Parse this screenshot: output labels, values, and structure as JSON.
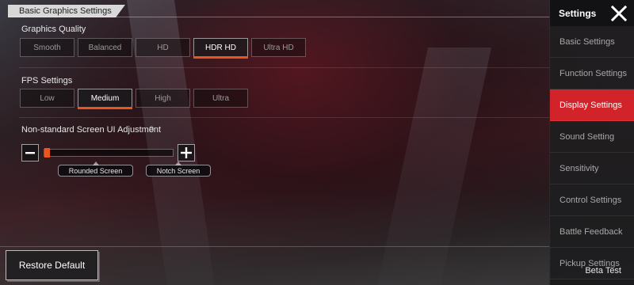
{
  "section_title": "Basic Graphics Settings",
  "graphics_quality": {
    "label": "Graphics Quality",
    "options": [
      "Smooth",
      "Balanced",
      "HD",
      "HDR HD",
      "Ultra HD"
    ],
    "selected": "HDR HD"
  },
  "fps_settings": {
    "label": "FPS Settings",
    "options": [
      "Low",
      "Medium",
      "High",
      "Ultra"
    ],
    "selected": "Medium"
  },
  "screen_adjustment": {
    "label": "Non-standard Screen UI Adjustment",
    "value": "0",
    "minus_icon": "minus-icon",
    "plus_icon": "plus-icon",
    "presets": [
      "Rounded Screen",
      "Notch Screen"
    ]
  },
  "restore_button": "Restore Default",
  "sidebar": {
    "title": "Settings",
    "close_icon": "close-icon",
    "items": [
      "Basic Settings",
      "Function Settings",
      "Display Settings",
      "Sound Setting",
      "Sensitivity",
      "Control Settings",
      "Battle Feedback",
      "Pickup Settings"
    ],
    "active": "Display Settings"
  },
  "beta_label": "Beta Test",
  "colors": {
    "accent": "#e8551f",
    "active_tab": "#d2232a"
  }
}
